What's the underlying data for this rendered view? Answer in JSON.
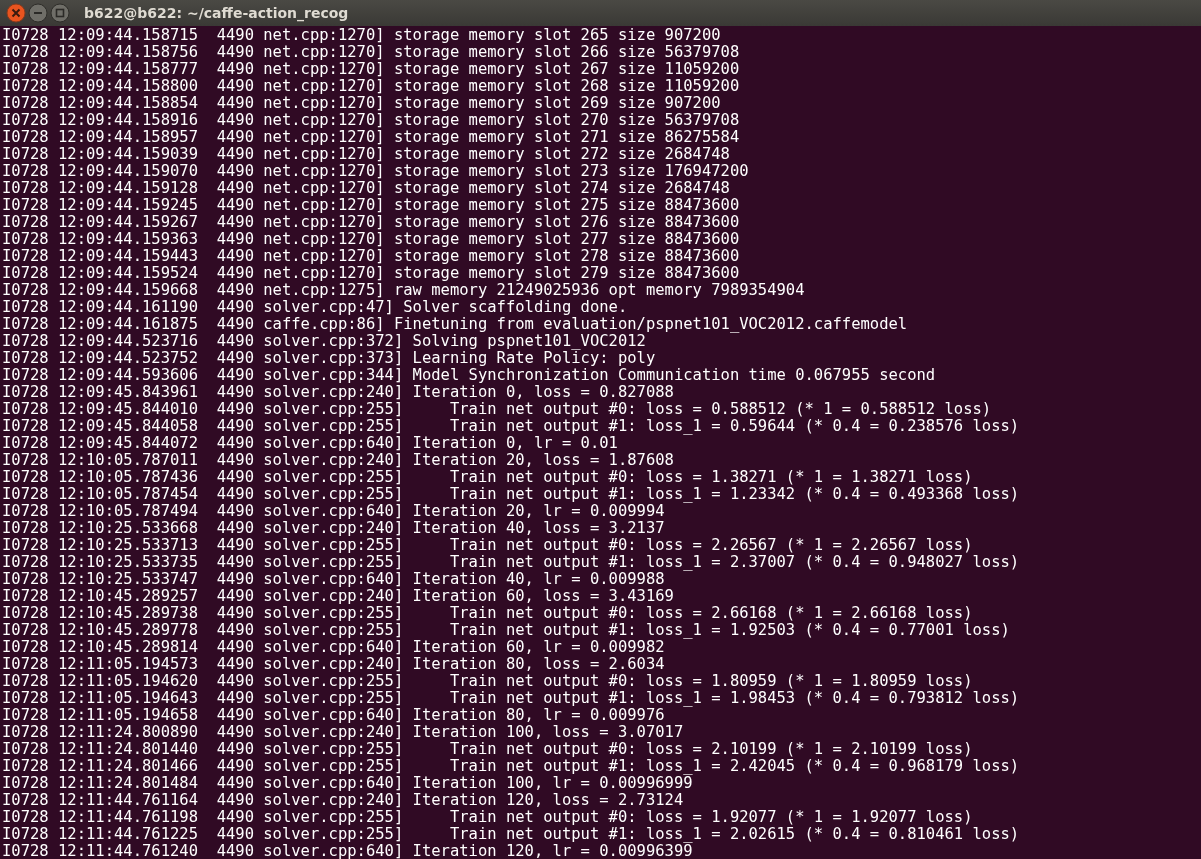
{
  "window": {
    "title": "b622@b622: ~/caffe-action_recog"
  },
  "terminal": {
    "lines": [
      "I0728 12:09:44.158715  4490 net.cpp:1270] storage memory slot 265 size 907200",
      "I0728 12:09:44.158756  4490 net.cpp:1270] storage memory slot 266 size 56379708",
      "I0728 12:09:44.158777  4490 net.cpp:1270] storage memory slot 267 size 11059200",
      "I0728 12:09:44.158800  4490 net.cpp:1270] storage memory slot 268 size 11059200",
      "I0728 12:09:44.158854  4490 net.cpp:1270] storage memory slot 269 size 907200",
      "I0728 12:09:44.158916  4490 net.cpp:1270] storage memory slot 270 size 56379708",
      "I0728 12:09:44.158957  4490 net.cpp:1270] storage memory slot 271 size 86275584",
      "I0728 12:09:44.159039  4490 net.cpp:1270] storage memory slot 272 size 2684748",
      "I0728 12:09:44.159070  4490 net.cpp:1270] storage memory slot 273 size 176947200",
      "I0728 12:09:44.159128  4490 net.cpp:1270] storage memory slot 274 size 2684748",
      "I0728 12:09:44.159245  4490 net.cpp:1270] storage memory slot 275 size 88473600",
      "I0728 12:09:44.159267  4490 net.cpp:1270] storage memory slot 276 size 88473600",
      "I0728 12:09:44.159363  4490 net.cpp:1270] storage memory slot 277 size 88473600",
      "I0728 12:09:44.159443  4490 net.cpp:1270] storage memory slot 278 size 88473600",
      "I0728 12:09:44.159524  4490 net.cpp:1270] storage memory slot 279 size 88473600",
      "I0728 12:09:44.159668  4490 net.cpp:1275] raw memory 21249025936 opt memory 7989354904",
      "I0728 12:09:44.161190  4490 solver.cpp:47] Solver scaffolding done.",
      "I0728 12:09:44.161875  4490 caffe.cpp:86] Finetuning from evaluation/pspnet101_VOC2012.caffemodel",
      "I0728 12:09:44.523716  4490 solver.cpp:372] Solving pspnet101_VOC2012",
      "I0728 12:09:44.523752  4490 solver.cpp:373] Learning Rate Policy: poly",
      "I0728 12:09:44.593606  4490 solver.cpp:344] Model Synchronization Communication time 0.067955 second",
      "I0728 12:09:45.843961  4490 solver.cpp:240] Iteration 0, loss = 0.827088",
      "I0728 12:09:45.844010  4490 solver.cpp:255]     Train net output #0: loss = 0.588512 (* 1 = 0.588512 loss)",
      "I0728 12:09:45.844058  4490 solver.cpp:255]     Train net output #1: loss_1 = 0.59644 (* 0.4 = 0.238576 loss)",
      "I0728 12:09:45.844072  4490 solver.cpp:640] Iteration 0, lr = 0.01",
      "I0728 12:10:05.787011  4490 solver.cpp:240] Iteration 20, loss = 1.87608",
      "I0728 12:10:05.787436  4490 solver.cpp:255]     Train net output #0: loss = 1.38271 (* 1 = 1.38271 loss)",
      "I0728 12:10:05.787454  4490 solver.cpp:255]     Train net output #1: loss_1 = 1.23342 (* 0.4 = 0.493368 loss)",
      "I0728 12:10:05.787494  4490 solver.cpp:640] Iteration 20, lr = 0.009994",
      "I0728 12:10:25.533668  4490 solver.cpp:240] Iteration 40, loss = 3.2137",
      "I0728 12:10:25.533713  4490 solver.cpp:255]     Train net output #0: loss = 2.26567 (* 1 = 2.26567 loss)",
      "I0728 12:10:25.533735  4490 solver.cpp:255]     Train net output #1: loss_1 = 2.37007 (* 0.4 = 0.948027 loss)",
      "I0728 12:10:25.533747  4490 solver.cpp:640] Iteration 40, lr = 0.009988",
      "I0728 12:10:45.289257  4490 solver.cpp:240] Iteration 60, loss = 3.43169",
      "I0728 12:10:45.289738  4490 solver.cpp:255]     Train net output #0: loss = 2.66168 (* 1 = 2.66168 loss)",
      "I0728 12:10:45.289778  4490 solver.cpp:255]     Train net output #1: loss_1 = 1.92503 (* 0.4 = 0.77001 loss)",
      "I0728 12:10:45.289814  4490 solver.cpp:640] Iteration 60, lr = 0.009982",
      "I0728 12:11:05.194573  4490 solver.cpp:240] Iteration 80, loss = 2.6034",
      "I0728 12:11:05.194620  4490 solver.cpp:255]     Train net output #0: loss = 1.80959 (* 1 = 1.80959 loss)",
      "I0728 12:11:05.194643  4490 solver.cpp:255]     Train net output #1: loss_1 = 1.98453 (* 0.4 = 0.793812 loss)",
      "I0728 12:11:05.194658  4490 solver.cpp:640] Iteration 80, lr = 0.009976",
      "I0728 12:11:24.800890  4490 solver.cpp:240] Iteration 100, loss = 3.07017",
      "I0728 12:11:24.801440  4490 solver.cpp:255]     Train net output #0: loss = 2.10199 (* 1 = 2.10199 loss)",
      "I0728 12:11:24.801466  4490 solver.cpp:255]     Train net output #1: loss_1 = 2.42045 (* 0.4 = 0.968179 loss)",
      "I0728 12:11:24.801484  4490 solver.cpp:640] Iteration 100, lr = 0.00996999",
      "I0728 12:11:44.761164  4490 solver.cpp:240] Iteration 120, loss = 2.73124",
      "I0728 12:11:44.761198  4490 solver.cpp:255]     Train net output #0: loss = 1.92077 (* 1 = 1.92077 loss)",
      "I0728 12:11:44.761225  4490 solver.cpp:255]     Train net output #1: loss_1 = 2.02615 (* 0.4 = 0.810461 loss)",
      "I0728 12:11:44.761240  4490 solver.cpp:640] Iteration 120, lr = 0.00996399"
    ]
  }
}
